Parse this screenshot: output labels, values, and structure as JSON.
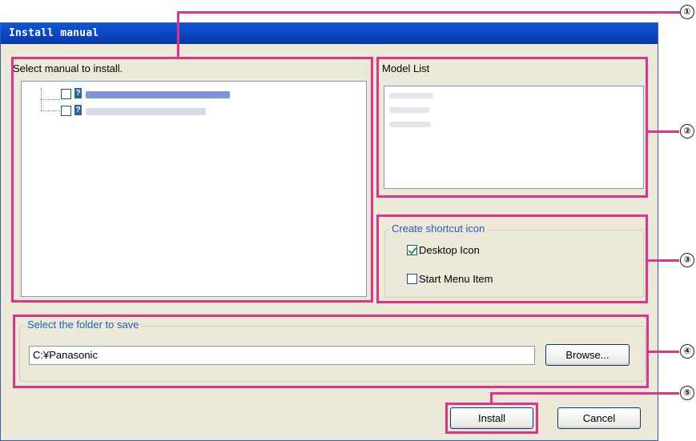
{
  "window": {
    "title": "Install manual"
  },
  "manuals": {
    "label": "Select manual to install.",
    "items": [
      {
        "checked": false,
        "icon": "help-book-icon",
        "name_visible": false
      },
      {
        "checked": false,
        "icon": "help-book-icon",
        "name_visible": false
      }
    ]
  },
  "model_list": {
    "label": "Model List"
  },
  "shortcut": {
    "legend": "Create shortcut icon",
    "desktop_label": "Desktop Icon",
    "desktop_checked": true,
    "start_menu_label": "Start Menu Item",
    "start_menu_checked": false
  },
  "folder": {
    "legend": "Select the folder to save",
    "path": "C:¥Panasonic",
    "browse_label": "Browse..."
  },
  "buttons": {
    "install": "Install",
    "cancel": "Cancel"
  },
  "callouts": [
    "①",
    "②",
    "③",
    "④",
    "⑤"
  ],
  "colors": {
    "highlight": "#e0338a",
    "title_bar": "#0b47c4",
    "legend_text": "#1f5fb8",
    "window_bg": "#ece9d8"
  }
}
